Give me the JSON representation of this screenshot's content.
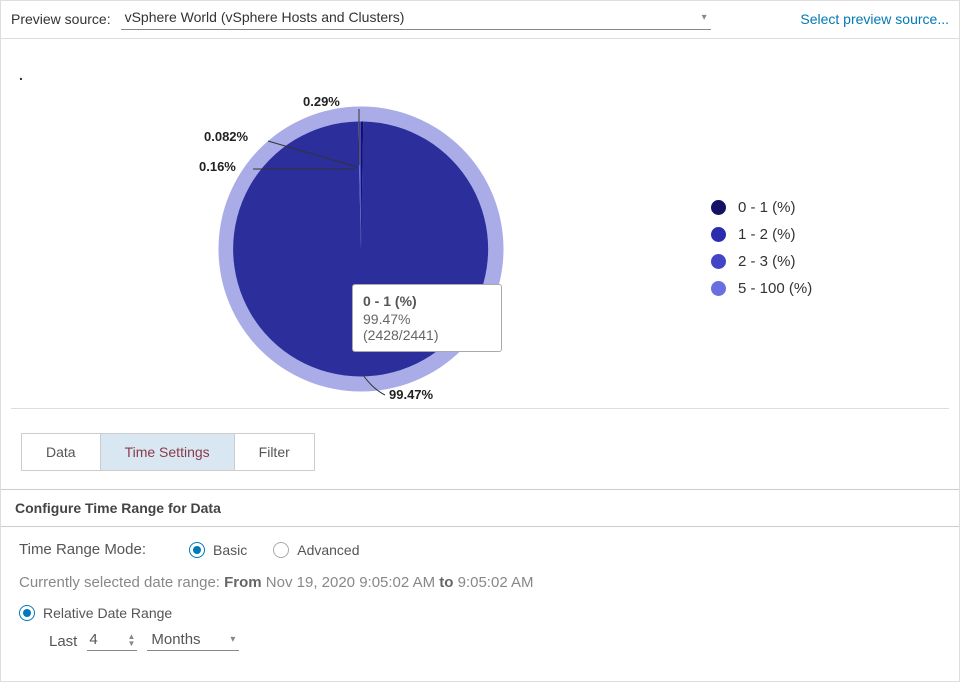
{
  "header": {
    "label": "Preview source:",
    "selected_source": "vSphere World (vSphere Hosts and Clusters)",
    "link": "Select preview source..."
  },
  "chart_data": {
    "type": "pie",
    "title": ".",
    "series": [
      {
        "name": "0 - 1 (%)",
        "value_pct": 99.47,
        "count": 2428,
        "total": 2441,
        "color": "#141263"
      },
      {
        "name": "1 - 2 (%)",
        "value_pct": 0.29,
        "color": "#2b2eac"
      },
      {
        "name": "2 - 3 (%)",
        "value_pct": 0.082,
        "color": "#4245c7"
      },
      {
        "name": "5 - 100 (%)",
        "value_pct": 0.16,
        "color": "#6a6fe0"
      }
    ],
    "ring_color": "#a9ace6"
  },
  "slice_labels": {
    "big": "99.47%",
    "small1": "0.29%",
    "small2": "0.082%",
    "small3": "0.16%"
  },
  "tooltip": {
    "title": "0 - 1 (%)",
    "line1": "99.47%",
    "line2": "(2428/2441)"
  },
  "legend": [
    {
      "label": "0 - 1 (%)",
      "color": "#141263"
    },
    {
      "label": "1 - 2 (%)",
      "color": "#2b2eac"
    },
    {
      "label": "2 - 3 (%)",
      "color": "#4245c7"
    },
    {
      "label": "5 - 100 (%)",
      "color": "#6a6fe0"
    }
  ],
  "tabs": {
    "data": "Data",
    "time": "Time Settings",
    "filter": "Filter"
  },
  "panel": {
    "title": "Configure Time Range for Data",
    "mode_label": "Time Range Mode:",
    "basic": "Basic",
    "advanced": "Advanced",
    "date_prefix": "Currently selected date range: ",
    "from_word": "From",
    "from_value": "Nov 19, 2020 9:05:02 AM",
    "to_word": "to",
    "to_value": "9:05:02 AM",
    "relative_option": "Relative Date Range",
    "last_word": "Last",
    "last_value": "4",
    "last_unit": "Months"
  }
}
